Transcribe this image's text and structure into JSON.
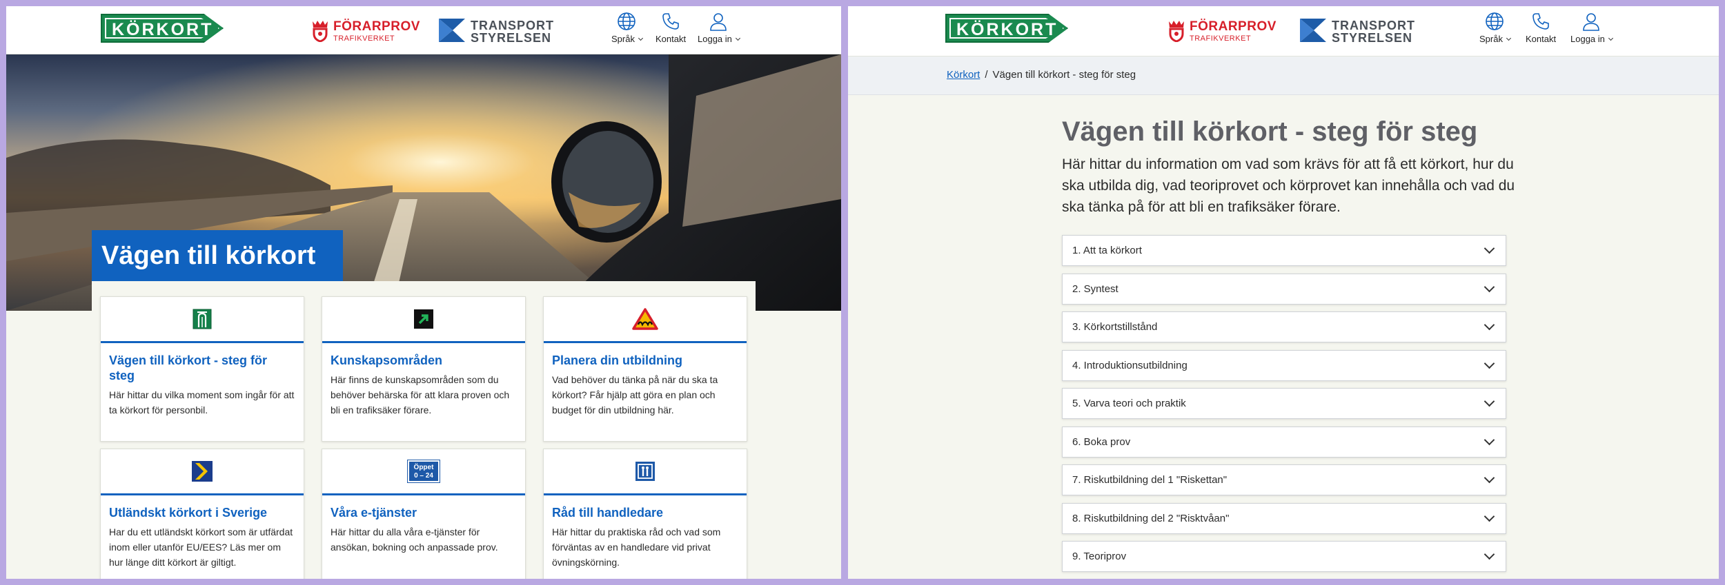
{
  "header": {
    "korkort_logo": "KÖRKORT",
    "forarprov_name": "FÖRARPROV",
    "forarprov_sub": "TRAFIKVERKET",
    "transport_line1": "TRANSPORT",
    "transport_line2": "STYRELSEN",
    "tools": [
      {
        "icon": "globe-icon",
        "label": "Språk"
      },
      {
        "icon": "phone-icon",
        "label": "Kontakt"
      },
      {
        "icon": "user-icon",
        "label": "Logga in"
      }
    ]
  },
  "left": {
    "hero_title": "Vägen till körkort",
    "cards": [
      {
        "icon": "motorway-sign-icon",
        "title": "Vägen till körkort - steg för steg",
        "text": "Här hittar du vilka moment som ingår för att ta körkort för personbil."
      },
      {
        "icon": "green-arrow-sign-icon",
        "title": "Kunskapsområden",
        "text": "Här finns de kunskapsområden som du behöver behärska för att klara proven och bli en trafiksäker förare."
      },
      {
        "icon": "warning-bumpy-road-icon",
        "title": "Planera din utbildning",
        "text": "Vad behöver du tänka på när du ska ta körkort? Får hjälp att göra en plan och budget för din utbildning här."
      },
      {
        "icon": "priority-road-sign-icon",
        "title": "Utländskt körkort i Sverige",
        "text": "Har du ett utländskt körkort som är utfärdat inom eller utanför EU/EES? Läs mer om hur länge ditt körkort är giltigt."
      },
      {
        "icon": "open-24-sign-icon",
        "icon_text_1": "Öppet",
        "icon_text_2": "0 – 24",
        "title": "Våra e-tjänster",
        "text": "Här hittar du alla våra e-tjänster för ansökan, bokning och anpassade prov."
      },
      {
        "icon": "pedestrian-sign-icon",
        "title": "Råd till handledare",
        "text": "Här hittar du praktiska råd och vad som förväntas av en handledare vid privat övningskörning."
      }
    ]
  },
  "right": {
    "breadcrumb_home": "Körkort",
    "breadcrumb_sep": "/",
    "breadcrumb_current": "Vägen till körkort - steg för steg",
    "title": "Vägen till körkort - steg för steg",
    "lead": "Här hittar du information om vad som krävs för att få ett körkort, hur du ska utbilda dig, vad teoriprovet och körprovet kan innehålla och vad du ska tänka på för att bli en trafiksäker förare.",
    "accordion": [
      "1. Att ta körkort",
      "2. Syntest",
      "3. Körkortstillstånd",
      "4. Introduktionsutbildning",
      "5. Varva teori och praktik",
      "6. Boka prov",
      "7. Riskutbildning del 1 \"Riskettan\"",
      "8. Riskutbildning del 2 \"Risktvåan\"",
      "9. Teoriprov"
    ]
  },
  "colors": {
    "brand_blue": "#1062bf",
    "korkort_green": "#1a8a4f",
    "forarprov_red": "#d71f2a",
    "frame": "#b9a8e2"
  }
}
